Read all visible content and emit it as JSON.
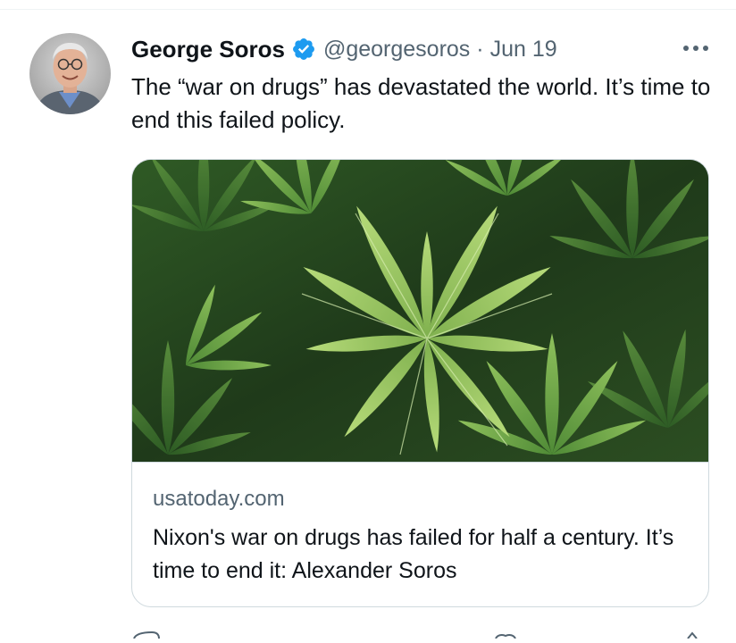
{
  "tweet": {
    "author": {
      "display_name": "George Soros",
      "handle": "@georgesoros",
      "verified": true,
      "avatar_icon": "profile-photo"
    },
    "separator": "·",
    "date": "Jun 19",
    "more_icon": "more-horizontal-icon",
    "text": "The “war on drugs” has devastated the world. It’s time to end this failed policy.",
    "card": {
      "image_description_icon": "cannabis-plant-photo",
      "domain": "usatoday.com",
      "title": "Nixon's war on drugs has failed for half a century. It’s time to end it: Alexander Soros"
    }
  },
  "colors": {
    "text_primary": "#0f1419",
    "text_secondary": "#536471",
    "verified_blue": "#1d9bf0",
    "border": "#cfd9de"
  }
}
